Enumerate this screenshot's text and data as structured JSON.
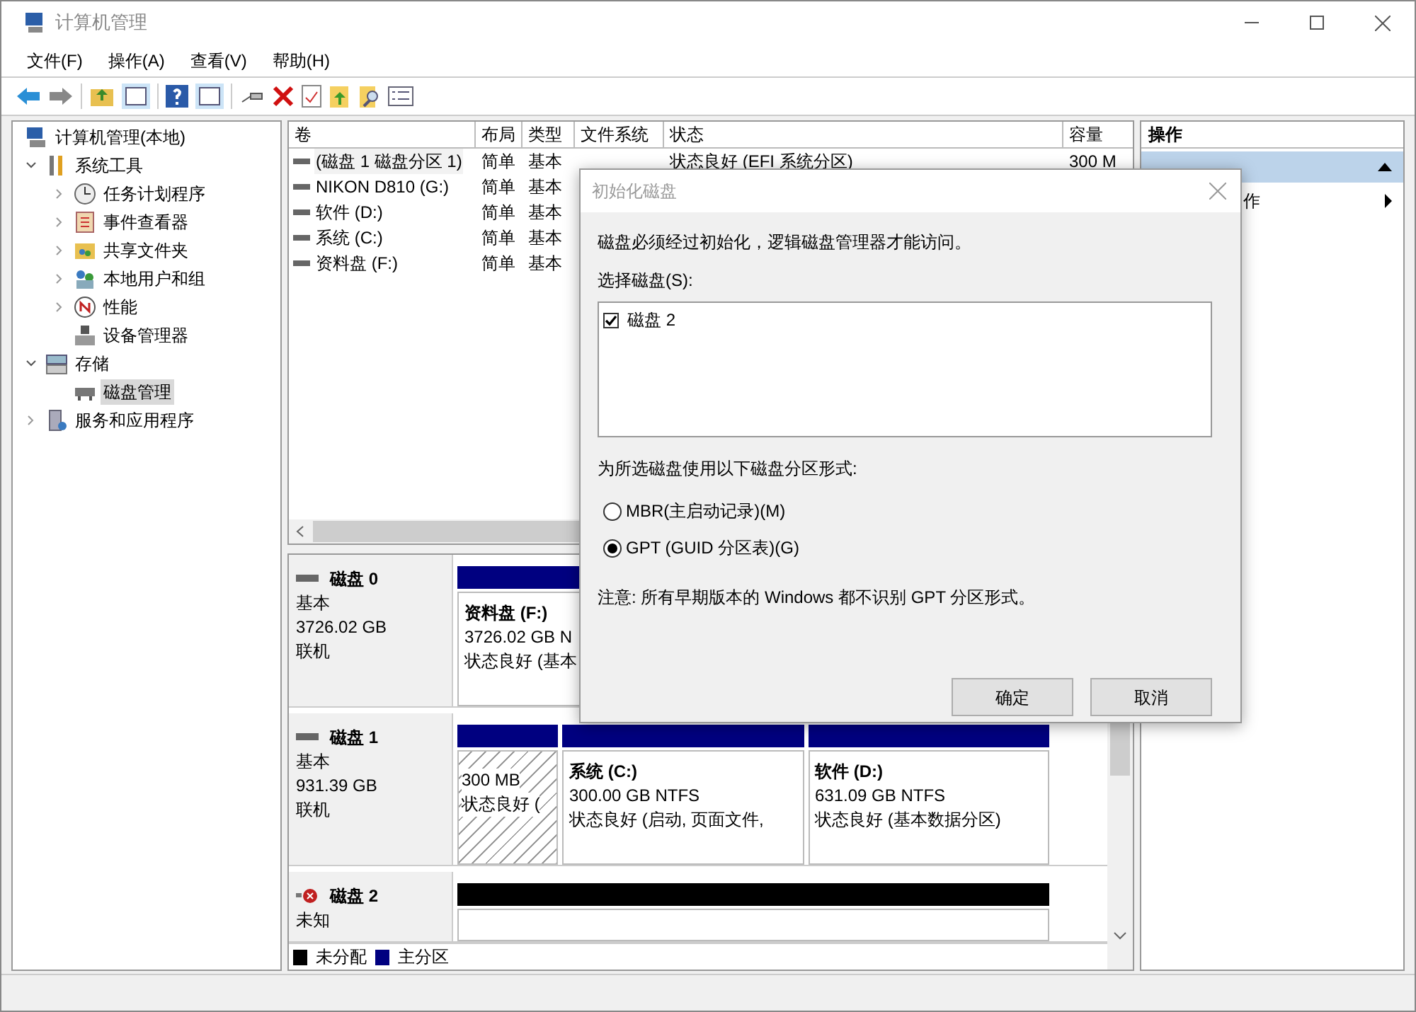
{
  "window": {
    "title": "计算机管理"
  },
  "menu": [
    "文件(F)",
    "操作(A)",
    "查看(V)",
    "帮助(H)"
  ],
  "tree": [
    {
      "label": "计算机管理(本地)",
      "selected": false,
      "children": [
        {
          "label": "系统工具",
          "expanded": true,
          "selected": false,
          "children": [
            {
              "label": "任务计划程序",
              "expanded": false,
              "selected": false
            },
            {
              "label": "事件查看器",
              "expanded": false,
              "selected": false
            },
            {
              "label": "共享文件夹",
              "expanded": false,
              "selected": false
            },
            {
              "label": "本地用户和组",
              "expanded": false,
              "selected": false
            },
            {
              "label": "性能",
              "expanded": false,
              "selected": false
            },
            {
              "label": "设备管理器",
              "selected": false
            }
          ]
        },
        {
          "label": "存储",
          "expanded": true,
          "selected": false,
          "children": [
            {
              "label": "磁盘管理",
              "selected": true
            }
          ]
        },
        {
          "label": "服务和应用程序",
          "expanded": false,
          "selected": false
        }
      ]
    }
  ],
  "volumes": {
    "columns": [
      "卷",
      "布局",
      "类型",
      "文件系统",
      "状态",
      "容量"
    ],
    "rows": [
      {
        "cells": [
          "(磁盘 1 磁盘分区 1)",
          "简单",
          "基本",
          "",
          "状态良好 (EFI 系统分区)",
          "300 M"
        ],
        "selected": true
      },
      {
        "cells": [
          "NIKON D810  (G:)",
          "简单",
          "基本"
        ],
        "selected": false
      },
      {
        "cells": [
          "软件 (D:)",
          "简单",
          "基本"
        ],
        "selected": false
      },
      {
        "cells": [
          "系统 (C:)",
          "简单",
          "基本"
        ],
        "selected": false
      },
      {
        "cells": [
          "资料盘 (F:)",
          "简单",
          "基本"
        ],
        "selected": false
      }
    ]
  },
  "disks": [
    {
      "name": "磁盘 0",
      "kind": "online",
      "lines": [
        "基本",
        "3726.02 GB",
        "联机"
      ],
      "partitions": [
        {
          "kind": "primary",
          "title": "资料盘  (F:)",
          "lines": [
            "3726.02 GB N",
            "状态良好 (基本"
          ]
        }
      ]
    },
    {
      "name": "磁盘 1",
      "kind": "online",
      "lines": [
        "基本",
        "931.39 GB",
        "联机"
      ],
      "partitions": [
        {
          "kind": "efi",
          "lines": [
            "300 MB",
            "状态良好 ("
          ]
        },
        {
          "kind": "primary",
          "title": "系统  (C:)",
          "lines": [
            "300.00 GB NTFS",
            "状态良好 (启动, 页面文件,"
          ]
        },
        {
          "kind": "primary",
          "title": "软件  (D:)",
          "lines": [
            "631.09 GB NTFS",
            "状态良好 (基本数据分区)"
          ]
        }
      ]
    },
    {
      "name": "磁盘 2",
      "kind": "uninitialized",
      "lines": [
        "未知"
      ],
      "partitions": [
        {
          "kind": "unallocated"
        }
      ]
    }
  ],
  "legend": [
    {
      "label": "未分配",
      "color": "#000000"
    },
    {
      "label": "主分区",
      "color": "#000080"
    }
  ],
  "actions": {
    "title": "操作",
    "items": [
      {
        "kind": "section"
      },
      {
        "kind": "submenu",
        "label": "作"
      }
    ]
  },
  "dialog": {
    "title": "初始化磁盘",
    "message": "磁盘必须经过初始化，逻辑磁盘管理器才能访问。",
    "select_label": "选择磁盘(S):",
    "disks": [
      {
        "label": "磁盘 2",
        "checked": true
      }
    ],
    "style_label": "为所选磁盘使用以下磁盘分区形式:",
    "options": [
      {
        "label": "MBR(主启动记录)(M)",
        "selected": false
      },
      {
        "label": "GPT (GUID 分区表)(G)",
        "selected": true
      }
    ],
    "note": "注意: 所有早期版本的 Windows 都不识别 GPT 分区形式。",
    "buttons": [
      "确定",
      "取消"
    ]
  }
}
